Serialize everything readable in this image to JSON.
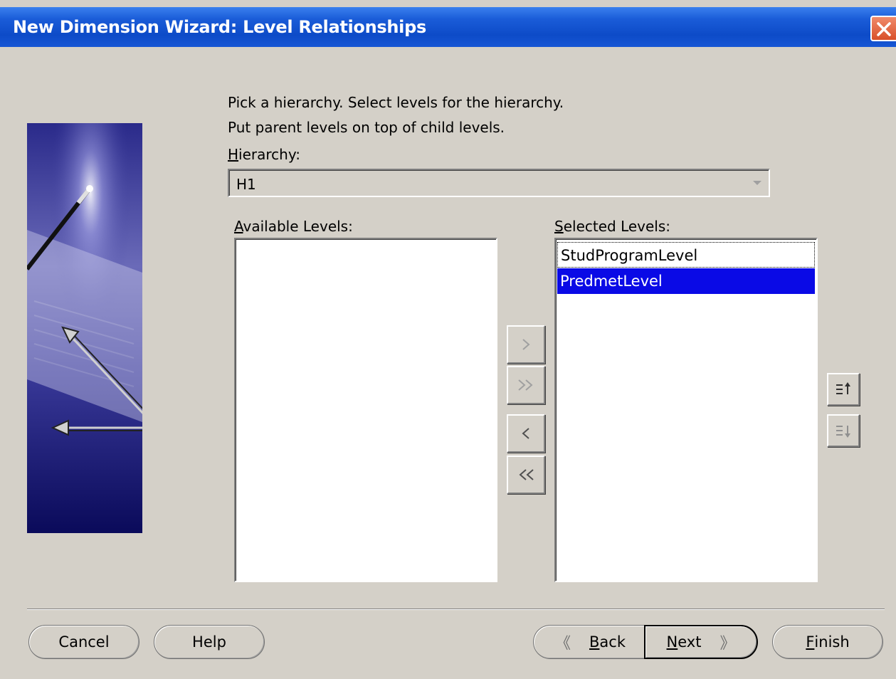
{
  "window": {
    "title": "New Dimension Wizard: Level Relationships",
    "close_label": "×"
  },
  "instructions": {
    "line1": "Pick a hierarchy. Select levels for the hierarchy.",
    "line2": "Put parent levels on top of child levels."
  },
  "hierarchy": {
    "label_mnemonic": "H",
    "label_rest": "ierarchy:",
    "value": "H1"
  },
  "available_levels": {
    "label_mnemonic": "A",
    "label_rest": "vailable Levels:",
    "items": []
  },
  "selected_levels": {
    "label_mnemonic": "S",
    "label_rest": "elected Levels:",
    "items": [
      "StudProgramLevel",
      "PredmetLevel"
    ],
    "selected_index": 1
  },
  "shuttle_buttons": {
    "move_right": "≫",
    "move_all_right": "»»",
    "move_left": "≪",
    "move_all_left": "««"
  },
  "order_buttons": {
    "up": "move-up",
    "down": "move-down"
  },
  "footer": {
    "cancel": "Cancel",
    "help": "Help",
    "back_mnemonic": "B",
    "back_rest": "ack",
    "back_symbol": "《",
    "next_mnemonic": "N",
    "next_rest": "ext",
    "next_symbol": "》",
    "finish_mnemonic": "F",
    "finish_rest": "inish"
  },
  "colors": {
    "dialog_bg": "#d4d0c8",
    "titlebar": "#0d4bc8",
    "selection": "#0a0ae6"
  }
}
